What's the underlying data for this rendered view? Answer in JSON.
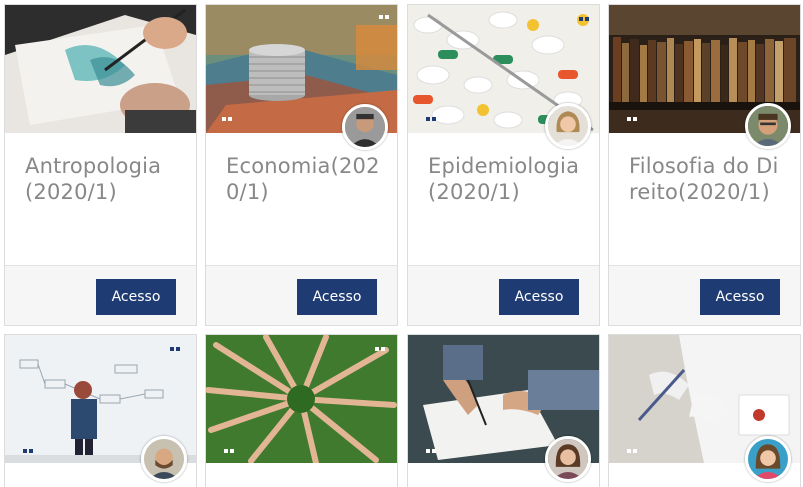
{
  "courses": [
    {
      "title": "Antropologia (2020/1)",
      "button": "Acesso"
    },
    {
      "title": "Economia(2020/1)",
      "button": "Acesso"
    },
    {
      "title": "Epidemiologia(2020/1)",
      "button": "Acesso"
    },
    {
      "title": "Filosofia do Direito(2020/1)",
      "button": "Acesso"
    }
  ],
  "colors": {
    "button": "#1f3b73",
    "title": "#888888",
    "footer": "#f6f6f6"
  }
}
